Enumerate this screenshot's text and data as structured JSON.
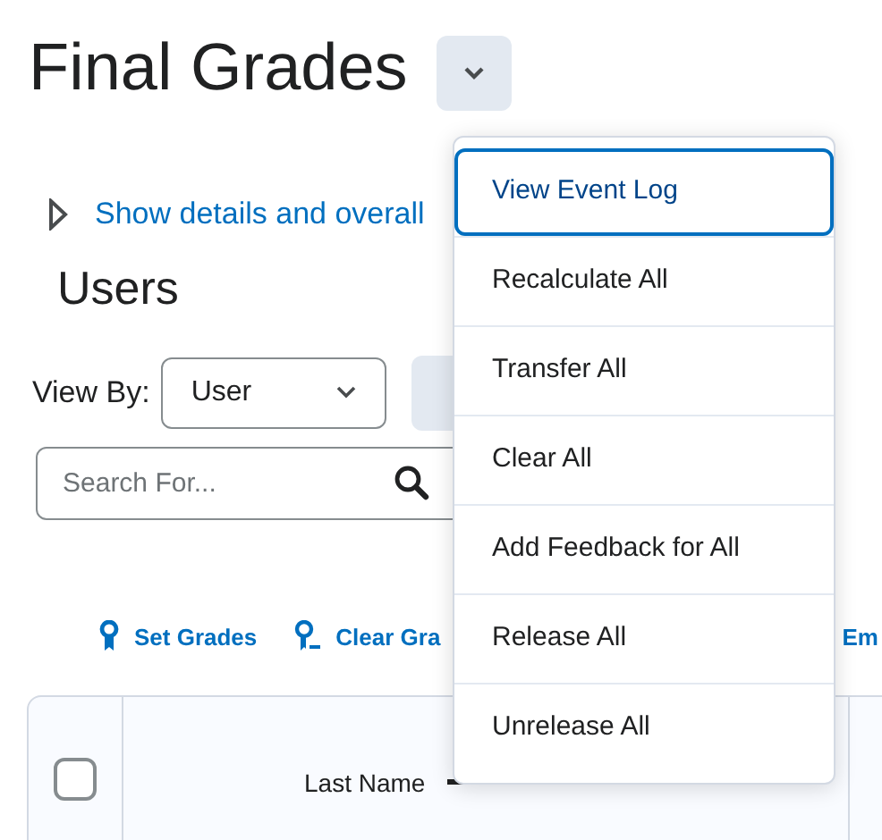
{
  "page": {
    "title": "Final Grades",
    "details_link": "Show details and overall",
    "section_title": "Users",
    "view_by": {
      "label": "View By:",
      "value": "User"
    },
    "search": {
      "placeholder": "Search For..."
    },
    "toolbar": [
      {
        "label": "Set Grades",
        "kind": "set"
      },
      {
        "label": "Clear Gra",
        "kind": "clear"
      },
      {
        "label": "Em",
        "kind": "plain"
      }
    ],
    "table": {
      "header_checked": false,
      "columns": [
        "Last Name"
      ]
    }
  },
  "menu": {
    "items": [
      {
        "label": "View Event Log",
        "focused": true
      },
      {
        "label": "Recalculate All",
        "focused": false
      },
      {
        "label": "Transfer All",
        "focused": false
      },
      {
        "label": "Clear All",
        "focused": false
      },
      {
        "label": "Add Feedback for All",
        "focused": false
      },
      {
        "label": "Release All",
        "focused": false
      },
      {
        "label": "Unrelease All",
        "focused": false
      }
    ]
  }
}
